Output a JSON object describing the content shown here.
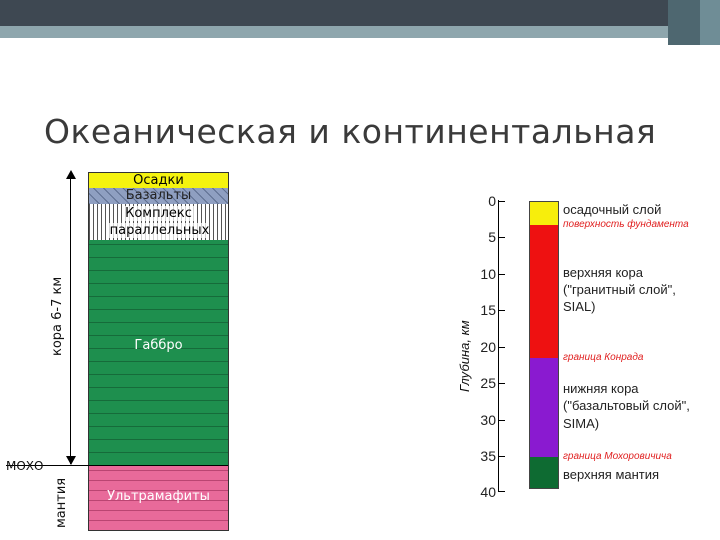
{
  "slide": {
    "title": "Океаническая и континентальная"
  },
  "ocean_column": {
    "layers": [
      {
        "label": "Осадки",
        "color": "#f5f30f"
      },
      {
        "label": "Базальты",
        "color": "#8f9fc1"
      },
      {
        "label": "Комплекс",
        "label2": "параллельных даек",
        "color": "#ffffff"
      },
      {
        "label": "Габбро",
        "color": "#1e8f4e"
      },
      {
        "label": "Ультрамафиты",
        "color": "#e86a9a"
      }
    ],
    "crust_label": "кора 6-7 км",
    "moho_label": "МОХО",
    "mantle_label": "мантия"
  },
  "continental_column": {
    "axis_label": "Глубина, км",
    "ticks": [
      "0",
      "5",
      "10",
      "15",
      "20",
      "25",
      "30",
      "35",
      "40"
    ],
    "layers": [
      {
        "color": "#f7ee0c"
      },
      {
        "color": "#ee1111"
      },
      {
        "color": "#8a1ad0"
      },
      {
        "color": "#0e6b32"
      }
    ],
    "labels": {
      "sediment": "осадочный слой",
      "basement": "поверхность фундамента",
      "upper1": "верхняя кора",
      "upper2": "(\"гранитный слой\",",
      "upper3": "SIAL)",
      "conrad": "граница Конрада",
      "lower1": "нижняя кора",
      "lower2": "(\"базальтовый слой\",",
      "lower3": "SIMA)",
      "moho": "граница Мохоровичича",
      "mantle": "верхняя мантия"
    }
  }
}
